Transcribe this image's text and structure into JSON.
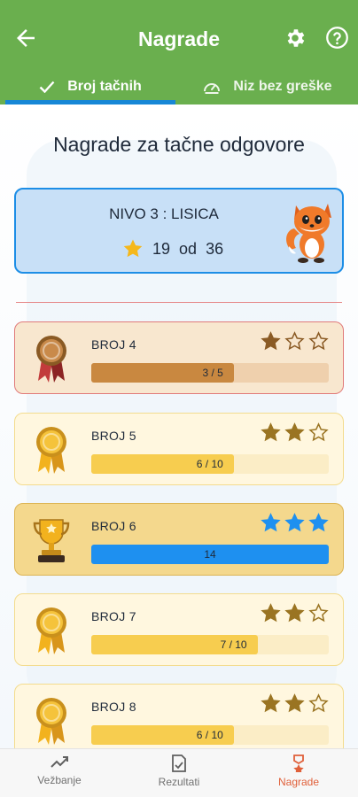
{
  "header": {
    "title": "Nagrade",
    "tabs": [
      {
        "label": "Broj tačnih",
        "active": true
      },
      {
        "label": "Niz bez greške",
        "active": false
      }
    ],
    "colors": {
      "bar": "#6aaf4e",
      "indicator": "#1787d6"
    }
  },
  "main": {
    "heading": "Nagrade za tačne odgovore",
    "level": {
      "title": "NIVO 3 : LISICA",
      "count": "19",
      "of": "od",
      "total": "36",
      "icon": "fox-icon"
    },
    "awards": [
      {
        "label": "BROJ 4",
        "progress": "3 / 5",
        "fraction": 0.6,
        "stars": 1,
        "medal": "bronze-medal-icon",
        "theme": "bronze"
      },
      {
        "label": "BROJ 5",
        "progress": "6 / 10",
        "fraction": 0.6,
        "stars": 2,
        "medal": "gold-medal-icon",
        "theme": "gold"
      },
      {
        "label": "BROJ 6",
        "progress": "14",
        "fraction": 1.0,
        "stars": 3,
        "medal": "trophy-icon",
        "theme": "complete"
      },
      {
        "label": "BROJ 7",
        "progress": "7 / 10",
        "fraction": 0.7,
        "stars": 2,
        "medal": "gold-medal-icon",
        "theme": "gold"
      },
      {
        "label": "BROJ 8",
        "progress": "6 / 10",
        "fraction": 0.6,
        "stars": 2,
        "medal": "gold-medal-icon",
        "theme": "gold"
      }
    ]
  },
  "bottom_nav": {
    "items": [
      {
        "label": "Vežbanje",
        "icon": "trend-icon",
        "active": false
      },
      {
        "label": "Rezultati",
        "icon": "results-icon",
        "active": false
      },
      {
        "label": "Nagrade",
        "icon": "award-icon",
        "active": true
      }
    ]
  }
}
